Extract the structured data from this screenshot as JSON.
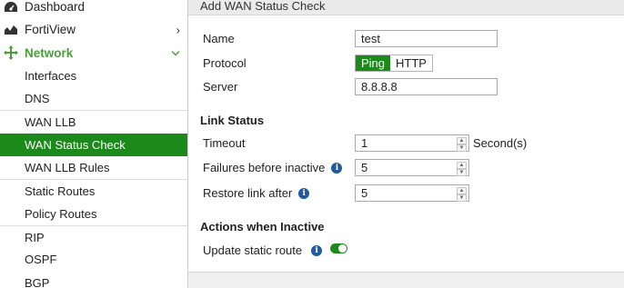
{
  "sidebar": {
    "items": [
      {
        "label": "Dashboard",
        "icon": "dashboard-icon"
      },
      {
        "label": "FortiView",
        "icon": "fortiview-chart-icon",
        "arrow": "›"
      },
      {
        "label": "Network",
        "icon": "network-icon",
        "arrow": "⌄"
      },
      {
        "label": "Interfaces"
      },
      {
        "label": "DNS"
      },
      {
        "label": "WAN LLB"
      },
      {
        "label": "WAN Status Check"
      },
      {
        "label": "WAN LLB Rules"
      },
      {
        "label": "Static Routes"
      },
      {
        "label": "Policy Routes"
      },
      {
        "label": "RIP"
      },
      {
        "label": "OSPF"
      },
      {
        "label": "BGP"
      }
    ],
    "active_index": 6,
    "accent_color": "#1b8a1b",
    "section_color": "#4a9d3a"
  },
  "form": {
    "title": "Add WAN Status Check",
    "name_label": "Name",
    "name_value": "test",
    "protocol_label": "Protocol",
    "protocol_options": [
      "Ping",
      "HTTP"
    ],
    "protocol_selected": "Ping",
    "server_label": "Server",
    "server_value": "8.8.8.8",
    "link_status_title": "Link Status",
    "timeout_label": "Timeout",
    "timeout_value": "1",
    "timeout_unit": "Second(s)",
    "failures_label": "Failures before inactive",
    "failures_value": "5",
    "restore_label": "Restore link after",
    "restore_value": "5",
    "actions_title": "Actions when Inactive",
    "update_route_label": "Update static route",
    "update_route_enabled": true
  }
}
